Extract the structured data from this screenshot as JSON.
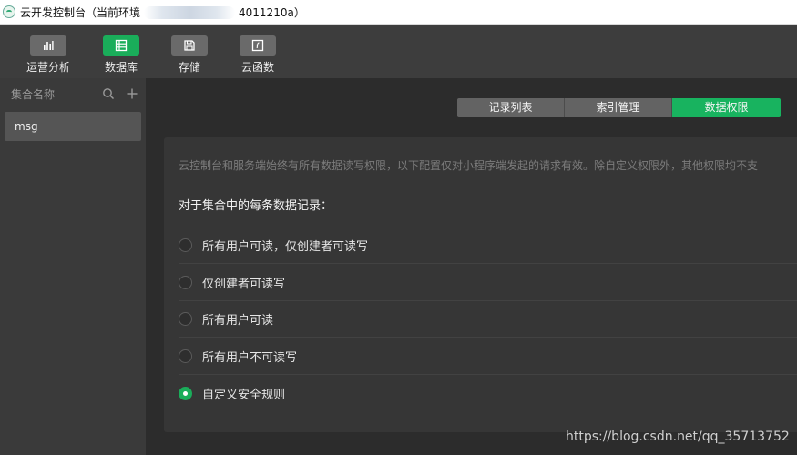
{
  "window": {
    "title_prefix": "云开发控制台（当前环境",
    "title_suffix": "4011210a）"
  },
  "toolbar": {
    "items": [
      {
        "label": "运营分析",
        "icon": "bar-chart-icon"
      },
      {
        "label": "数据库",
        "icon": "database-icon"
      },
      {
        "label": "存储",
        "icon": "save-icon"
      },
      {
        "label": "云函数",
        "icon": "function-icon"
      }
    ],
    "active": "数据库"
  },
  "sidebar": {
    "header": "集合名称",
    "collections": [
      "msg"
    ]
  },
  "tabs": [
    {
      "label": "记录列表"
    },
    {
      "label": "索引管理"
    },
    {
      "label": "数据权限"
    }
  ],
  "permissions": {
    "note": "云控制台和服务端始终有所有数据读写权限，以下配置仅对小程序端发起的请求有效。除自定义权限外，其他权限均不支",
    "subheading": "对于集合中的每条数据记录：",
    "options": [
      {
        "label": "所有用户可读，仅创建者可读写",
        "selected": false
      },
      {
        "label": "仅创建者可读写",
        "selected": false
      },
      {
        "label": "所有用户可读",
        "selected": false
      },
      {
        "label": "所有用户不可读写",
        "selected": false
      },
      {
        "label": "自定义安全规则",
        "selected": true
      }
    ]
  },
  "watermark": "https://blog.csdn.net/qq_35713752",
  "colors": {
    "accent": "#1aad5a",
    "toolbar": "#3d3d3d",
    "sidebar": "#3a3a3a",
    "panel": "#363636"
  }
}
